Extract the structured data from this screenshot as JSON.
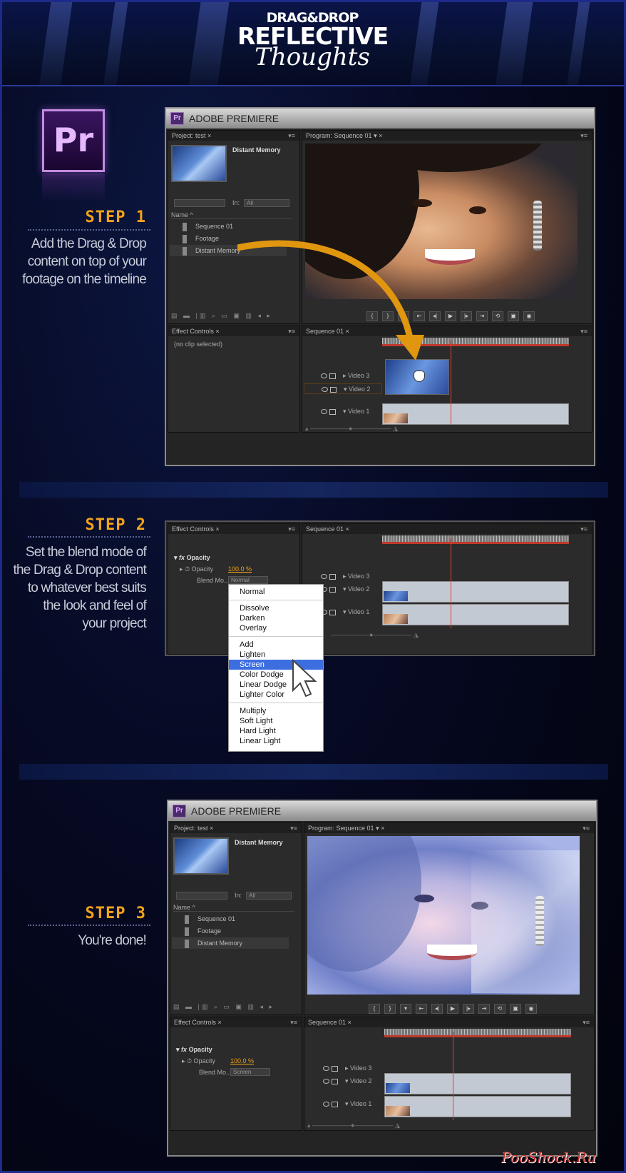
{
  "logo": {
    "line1": "DRAG&DROP",
    "line2": "REFLECTIVE",
    "line3": "Thoughts"
  },
  "pr_icon_label": "Pr",
  "steps": [
    {
      "label": "STEP 1",
      "text": [
        "Add the Drag & Drop",
        "content on top of your",
        "footage on the timeline"
      ]
    },
    {
      "label": "STEP 2",
      "text": [
        "Set the blend mode of",
        "the Drag & Drop content",
        "to whatever best suits",
        "the  look and feel of",
        "your project"
      ]
    },
    {
      "label": "STEP 3",
      "text": [
        "You're done!"
      ]
    }
  ],
  "app_title": "ADOBE PREMIERE",
  "project_panel": {
    "tab": "Project: test",
    "clip_name": "Distant Memory",
    "in_label": "In:",
    "in_value": "All",
    "column_name": "Name",
    "items": [
      "Sequence 01",
      "Footage",
      "Distant Memory"
    ]
  },
  "program_panel": {
    "tab": "Program: Sequence 01"
  },
  "effect_controls": {
    "tab": "Effect Controls",
    "no_clip": "(no clip selected)",
    "fx": "fx",
    "opacity_group": "Opacity",
    "opacity_param": "Opacity",
    "opacity_value": "100.0 %",
    "blend_label": "Blend Mo...",
    "blend_value_step2": "Normal",
    "blend_value_step3": "Screen"
  },
  "sequence_panel": {
    "tab": "Sequence 01",
    "tracks": [
      "Video 3",
      "Video 2",
      "Video 1"
    ]
  },
  "blend_menu": {
    "groups": [
      [
        "Normal"
      ],
      [
        "Dissolve",
        "Darken",
        "Overlay"
      ],
      [
        "Add",
        "Lighten",
        "Screen",
        "Color Dodge",
        "Linear Dodge",
        "Lighter Color"
      ],
      [
        "Multiply",
        "Soft Light",
        "Hard Light",
        "Linear Light"
      ]
    ],
    "selected": "Screen"
  },
  "watermark": "PooShock.Ru",
  "colors": {
    "accent_orange": "#f0a21c",
    "border_blue": "#1d2a8a",
    "menu_highlight": "#3d6ee0",
    "playhead_red": "#e04030"
  }
}
